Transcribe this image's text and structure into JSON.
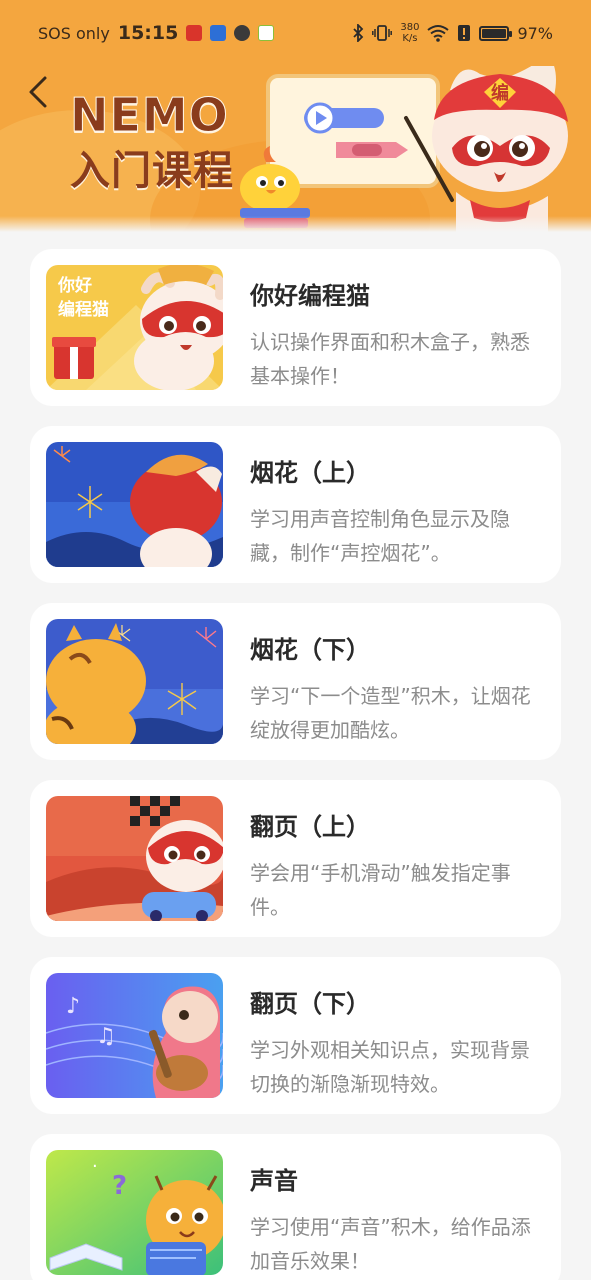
{
  "status_bar": {
    "carrier": "SOS only",
    "time": "15:15",
    "net_speed_value": "380",
    "net_speed_unit": "K/s",
    "battery": "97%",
    "battery_level": 0.97
  },
  "header": {
    "title_en": "NEMO",
    "title_cn": "入门课程",
    "mascot_badge": "编"
  },
  "thumb_captions": {
    "hello_line1": "你好",
    "hello_line2": "编程猫"
  },
  "courses": [
    {
      "title": "你好编程猫",
      "desc": "认识操作界面和积木盒子，熟悉基本操作！"
    },
    {
      "title": "烟花（上）",
      "desc": "学习用声音控制角色显示及隐藏，制作“声控烟花”。"
    },
    {
      "title": "烟花（下）",
      "desc": "学习“下一个造型”积木，让烟花绽放得更加酷炫。"
    },
    {
      "title": "翻页（上）",
      "desc": "学会用“手机滑动”触发指定事件。"
    },
    {
      "title": "翻页（下）",
      "desc": "学习外观相关知识点，实现背景切换的渐隐渐现特效。"
    },
    {
      "title": "声音",
      "desc": "学习使用“声音”积木，给作品添加音乐效果！"
    }
  ],
  "colors": {
    "header_bg": "#f4a63f",
    "title_text": "#8a3c1c",
    "card_bg": "#ffffff",
    "page_bg": "#f5f5f5"
  }
}
